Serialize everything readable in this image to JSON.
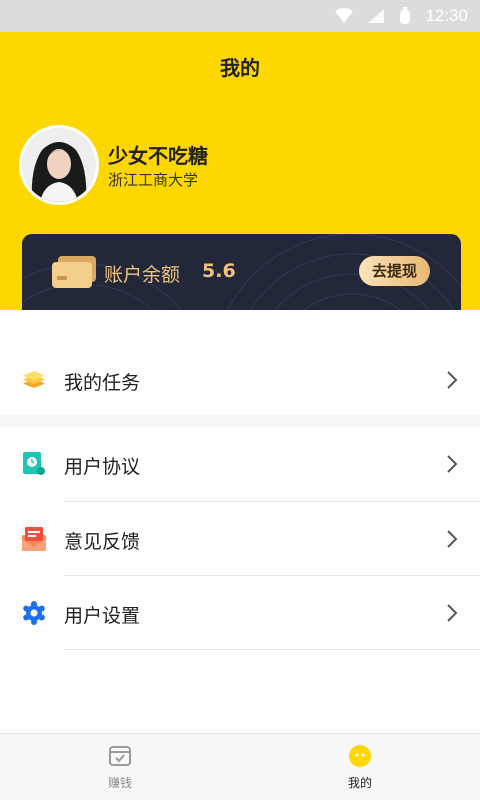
{
  "status_bar": {
    "time": "12:30"
  },
  "header": {
    "title": "我的"
  },
  "profile": {
    "name": "少女不吃糖",
    "school": "浙江工商大学"
  },
  "balance": {
    "label": "账户余额",
    "value": "5.6",
    "withdraw_label": "去提现"
  },
  "menu": {
    "tasks": {
      "label": "我的任务",
      "icon": "layers-icon"
    },
    "agreement": {
      "label": "用户协议",
      "icon": "document-clock-icon"
    },
    "feedback": {
      "label": "意见反馈",
      "icon": "mail-icon"
    },
    "settings": {
      "label": "用户设置",
      "icon": "gear-icon"
    }
  },
  "tabs": {
    "earn": {
      "label": "赚钱",
      "icon": "checklist-icon"
    },
    "mine": {
      "label": "我的",
      "icon": "smile-icon",
      "active": true
    }
  },
  "colors": {
    "brand_yellow": "#ffd700",
    "card_dark": "#23273a",
    "gold_text": "#f0c27d"
  }
}
